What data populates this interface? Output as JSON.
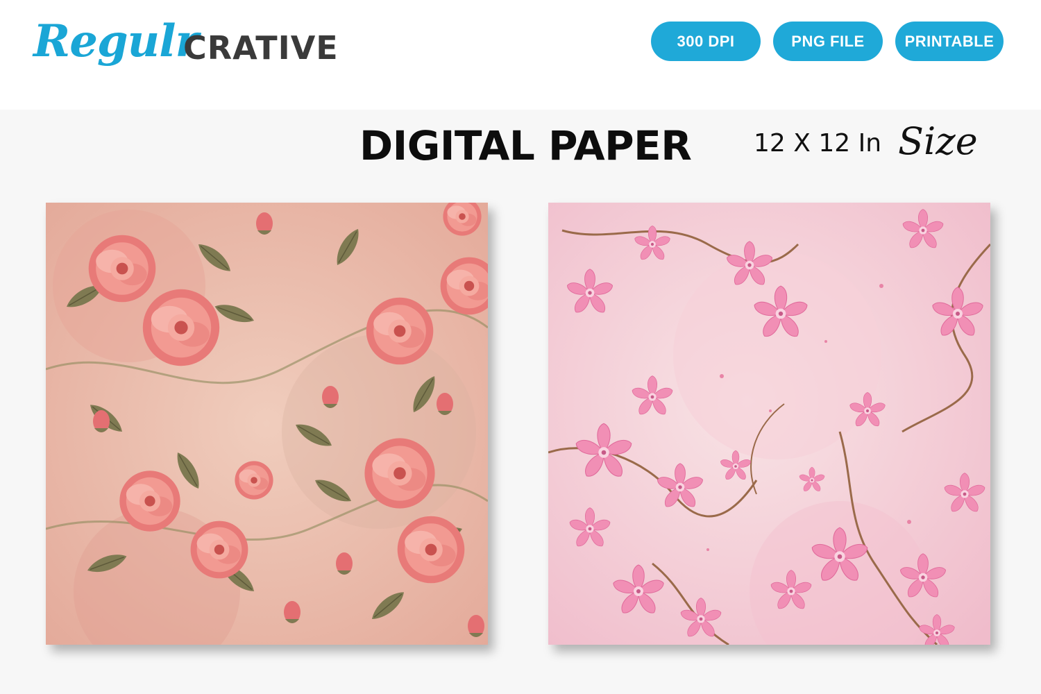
{
  "brand": {
    "script": "Regulr",
    "block": "CRATIVE"
  },
  "badges": [
    "300 DPI",
    "PNG FILE",
    "PRINTABLE"
  ],
  "headline": "DIGITAL PAPER",
  "size": {
    "label": "12 X 12 In",
    "script": "Size"
  },
  "papers": [
    {
      "name": "vintage-rose-paper",
      "palette": {
        "base": "#e9b5a6",
        "flower": "#ea7b7b",
        "leaf": "#7d7a52"
      }
    },
    {
      "name": "cherry-blossom-paper",
      "palette": {
        "base": "#f3c9d2",
        "flower": "#ef8fb6",
        "branch": "#9a6a4a"
      }
    }
  ],
  "colors": {
    "accent": "#1fa9d8",
    "brand_script": "#1aa6d6",
    "brand_block": "#3a3a3a",
    "headline": "#0d0d0d"
  }
}
